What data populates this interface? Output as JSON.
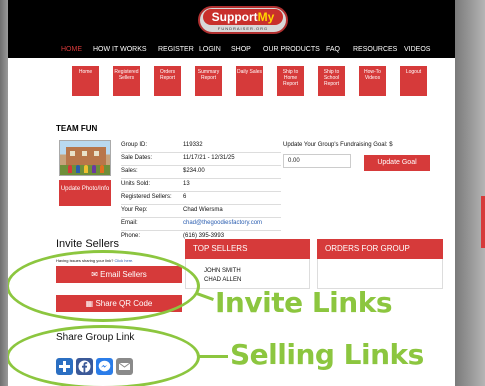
{
  "logo": {
    "brand_main": "Support",
    "brand_highlight": "My",
    "brand_sub": "FUNDRAISER.ORG"
  },
  "nav": [
    "HOME",
    "HOW IT WORKS",
    "REGISTER",
    "LOGIN",
    "SHOP",
    "OUR PRODUCTS",
    "FAQ",
    "RESOURCES",
    "VIDEOS"
  ],
  "toolbar": [
    "Home",
    "Registered Sellers",
    "Orders Report",
    "Summary Report",
    "Daily Sales",
    "Ship to Home Report",
    "Ship to School Report",
    "How-To Videos",
    "Logout"
  ],
  "team": {
    "title": "TEAM FUN",
    "update_photo_label": "Update Photo/Info",
    "info": [
      {
        "key": "Group ID:",
        "value": "119332"
      },
      {
        "key": "Sale Dates:",
        "value": "11/17/21 - 12/31/25"
      },
      {
        "key": "Sales:",
        "value": "$234.00"
      },
      {
        "key": "Units Sold:",
        "value": "13"
      },
      {
        "key": "Registered Sellers:",
        "value": "6"
      },
      {
        "key": "Your Rep:",
        "value": "Chad Wiersma"
      },
      {
        "key": "Email:",
        "value": "chad@thegoodiesfactory.com"
      },
      {
        "key": "Phone:",
        "value": "(616) 395-3993"
      }
    ]
  },
  "goal": {
    "label": "Update Your Group's Fundraising Goal: $",
    "value": "0.00",
    "button": "Update Goal"
  },
  "invite": {
    "title": "Invite Sellers",
    "help_text": "Having issues sharing your link?",
    "help_link": "Click here.",
    "email_button": "Email Sellers",
    "qr_button": "Share QR Code"
  },
  "share": {
    "title": "Share Group Link"
  },
  "top_sellers": {
    "title": "TOP SELLERS",
    "names": [
      "JOHN SMITH",
      "CHAD ALLEN"
    ]
  },
  "orders": {
    "title": "ORDERS FOR GROUP"
  },
  "annotations": {
    "invite_label": "Invite Links",
    "selling_label": "Selling Links",
    "color": "#8cc63f"
  },
  "colors": {
    "brand_red": "#d63a3a",
    "header_bg": "#000000",
    "link_blue": "#2a5db0"
  }
}
